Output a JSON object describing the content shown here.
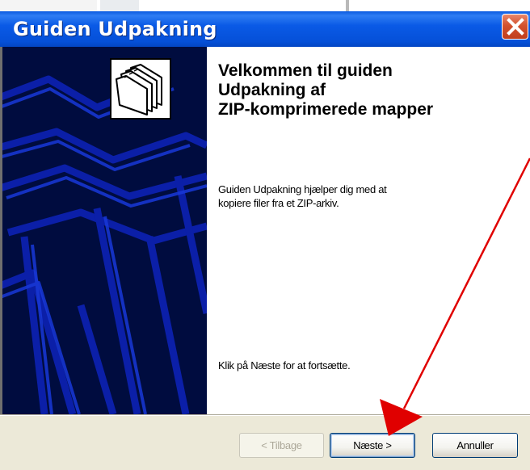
{
  "window": {
    "title": "Guiden Udpakning"
  },
  "content": {
    "heading_lines": [
      "Velkommen til guiden",
      "Udpakning af",
      "ZIP-komprimerede mapper"
    ],
    "description_lines": [
      "Guiden Udpakning hjælper dig med at",
      "kopiere filer fra et ZIP-arkiv."
    ],
    "continue_hint": "Klik på Næste for at fortsætte."
  },
  "buttons": {
    "back_label": "< Tilbage",
    "back_enabled": false,
    "next_label": "Næste >",
    "cancel_label": "Annuller"
  },
  "colors": {
    "titlebar": "#0a5ae0",
    "side_panel": "#000c3f",
    "dialog_face": "#ece9d8",
    "close_button": "#d2512e",
    "annotation_arrow": "#e00000"
  },
  "icons": {
    "close": "close-icon",
    "wizard": "compressed-folders-icon"
  }
}
